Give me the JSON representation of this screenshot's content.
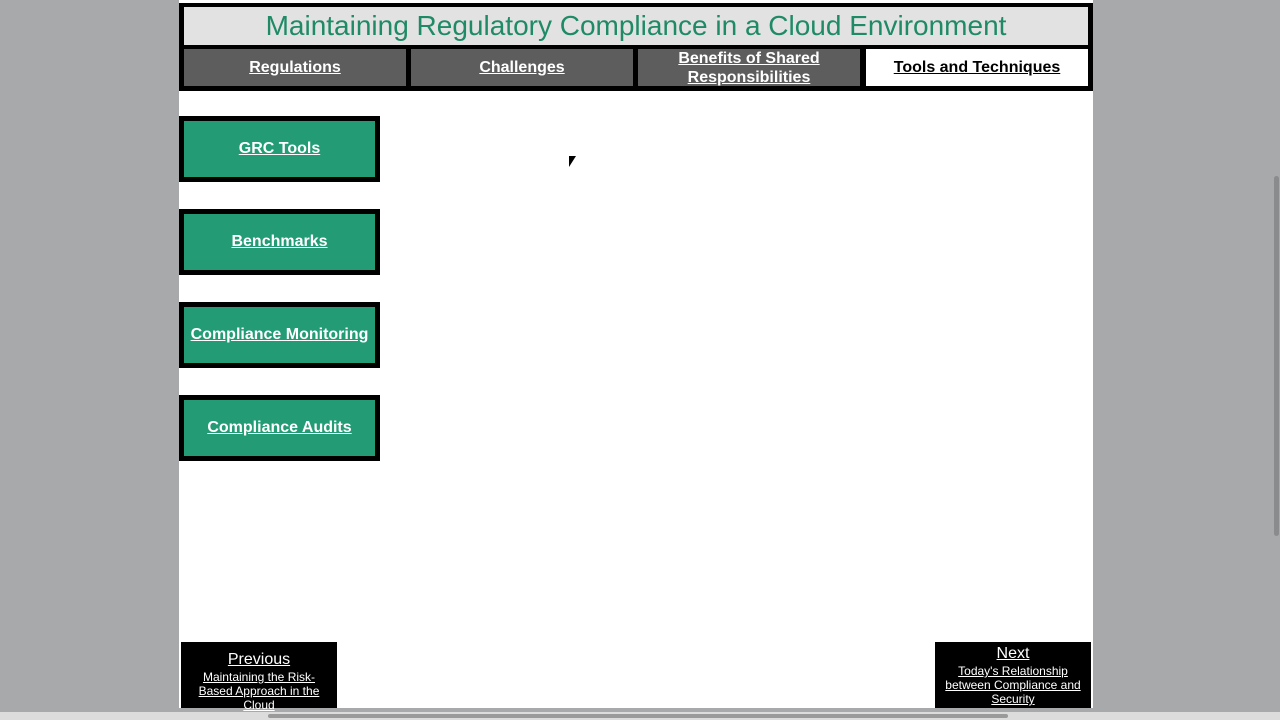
{
  "title": "Maintaining Regulatory Compliance in a Cloud Environment",
  "tabs": [
    {
      "label": "Regulations",
      "active": false
    },
    {
      "label": "Challenges",
      "active": false
    },
    {
      "label": "Benefits of Shared Responsibilities",
      "active": false
    },
    {
      "label": "Tools and Techniques",
      "active": true
    }
  ],
  "side_buttons": [
    {
      "label": "GRC Tools"
    },
    {
      "label": "Benchmarks"
    },
    {
      "label": "Compliance Monitoring"
    },
    {
      "label": "Compliance Audits"
    }
  ],
  "nav": {
    "previous_label": "Previous",
    "previous_sub": "Maintaining the Risk-Based Approach in the Cloud",
    "next_label": "Next",
    "next_sub": "Today's Relationship between Compliance and Security"
  },
  "colors": {
    "accent_green": "#239b75",
    "title_green": "#1f8a66",
    "tab_gray": "#5d5d5d",
    "background": "#a8a9ab"
  }
}
